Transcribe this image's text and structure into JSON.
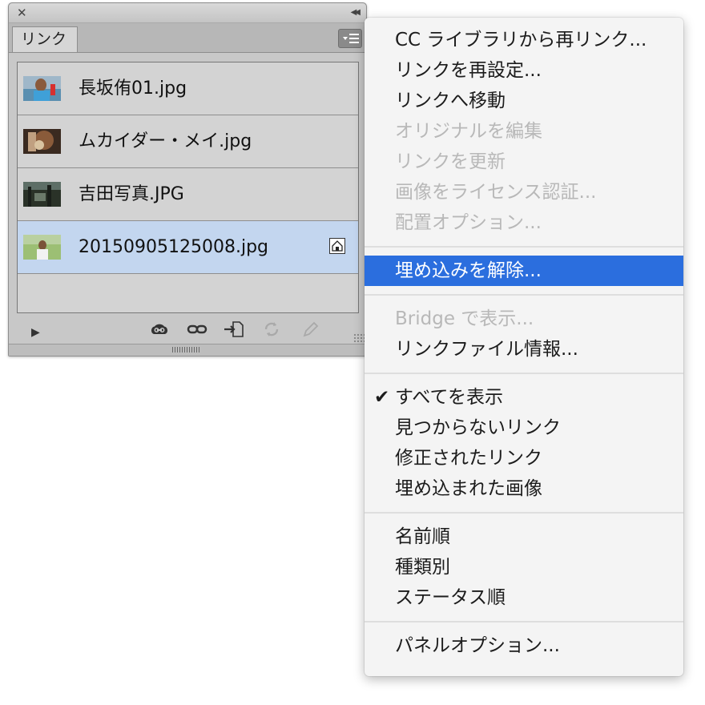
{
  "panel": {
    "tab_label": "リンク",
    "links": [
      {
        "name": "長坂侑01.jpg",
        "selected": false,
        "embedded": false
      },
      {
        "name": "ムカイダー・メイ.jpg",
        "selected": false,
        "embedded": false
      },
      {
        "name": "吉田写真.JPG",
        "selected": false,
        "embedded": false
      },
      {
        "name": "20150905125008.jpg",
        "selected": true,
        "embedded": true
      }
    ],
    "footer_icons": [
      "show-details-triangle-icon",
      "cc-library-icon",
      "relink-icon",
      "goto-link-icon",
      "update-link-icon",
      "edit-original-icon"
    ]
  },
  "menu": {
    "group1": [
      "CC ライブラリから再リンク...",
      "リンクを再設定...",
      "リンクへ移動",
      "オリジナルを編集",
      "リンクを更新",
      "画像をライセンス認証...",
      "配置オプション..."
    ],
    "group2": [
      "埋め込みを解除..."
    ],
    "group3": [
      "Bridge で表示...",
      "リンクファイル情報..."
    ],
    "group4": [
      "すべてを表示",
      "見つからないリンク",
      "修正されたリンク",
      "埋め込まれた画像"
    ],
    "group5": [
      "名前順",
      "種類別",
      "ステータス順"
    ],
    "group6": [
      "パネルオプション..."
    ],
    "check_mark": "✔",
    "highlight_color": "#2b6ede",
    "disabled_color": "#b8b8b8"
  }
}
